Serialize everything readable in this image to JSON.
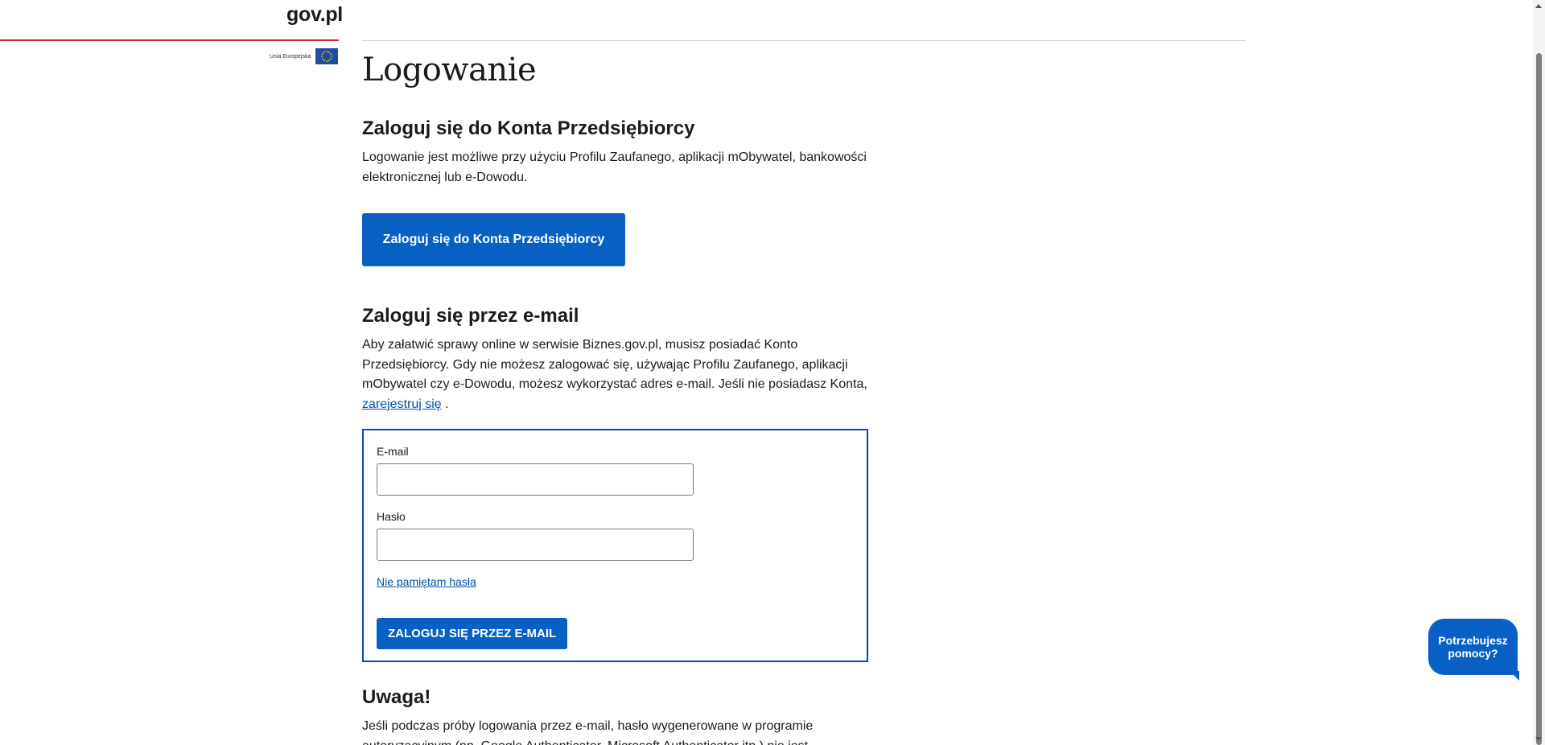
{
  "header": {
    "logo_text": "gov.pl",
    "eu_label": "Unia Europejska"
  },
  "main": {
    "page_title": "Logowanie",
    "konto_section": {
      "title": "Zaloguj się do Konta Przedsiębiorcy",
      "description": "Logowanie jest możliwe przy użyciu Profilu Zaufanego, aplikacji mObywatel, bankowości elektronicznej lub e-Dowodu.",
      "button_label": "Zaloguj się do Konta Przedsiębiorcy"
    },
    "email_section": {
      "title": "Zaloguj się przez e-mail",
      "description": "Aby załatwić sprawy online w serwisie Biznes.gov.pl, musisz posiadać Konto Przedsiębiorcy. Gdy nie możesz zalogować się, używając Profilu Zaufanego, aplikacji mObywatel czy e-Dowodu, możesz wykorzystać adres e-mail. Jeśli nie posiadasz Konta, ",
      "register_link": "zarejestruj się",
      "after_link": " ."
    },
    "login_form": {
      "email_label": "E-mail",
      "email_value": "",
      "password_label": "Hasło",
      "password_value": "",
      "forgot_link": "Nie pamiętam hasła",
      "submit_label": "ZALOGUJ SIĘ PRZEZ E-MAIL"
    },
    "warning_section": {
      "title": "Uwaga!",
      "text": "Jeśli podczas próby logowania przez e-mail, hasło wygenerowane w programie autoryzacyjnym (np. Google Authenticator, Microsoft Authenticator itp.) nie jest"
    }
  },
  "help_bubble": {
    "label": "Potrzebujesz pomocy?"
  },
  "colors": {
    "primary": "#0860c4",
    "accent_red": "#d4213d",
    "link": "#0052a5",
    "form_border": "#0c4aa0"
  }
}
